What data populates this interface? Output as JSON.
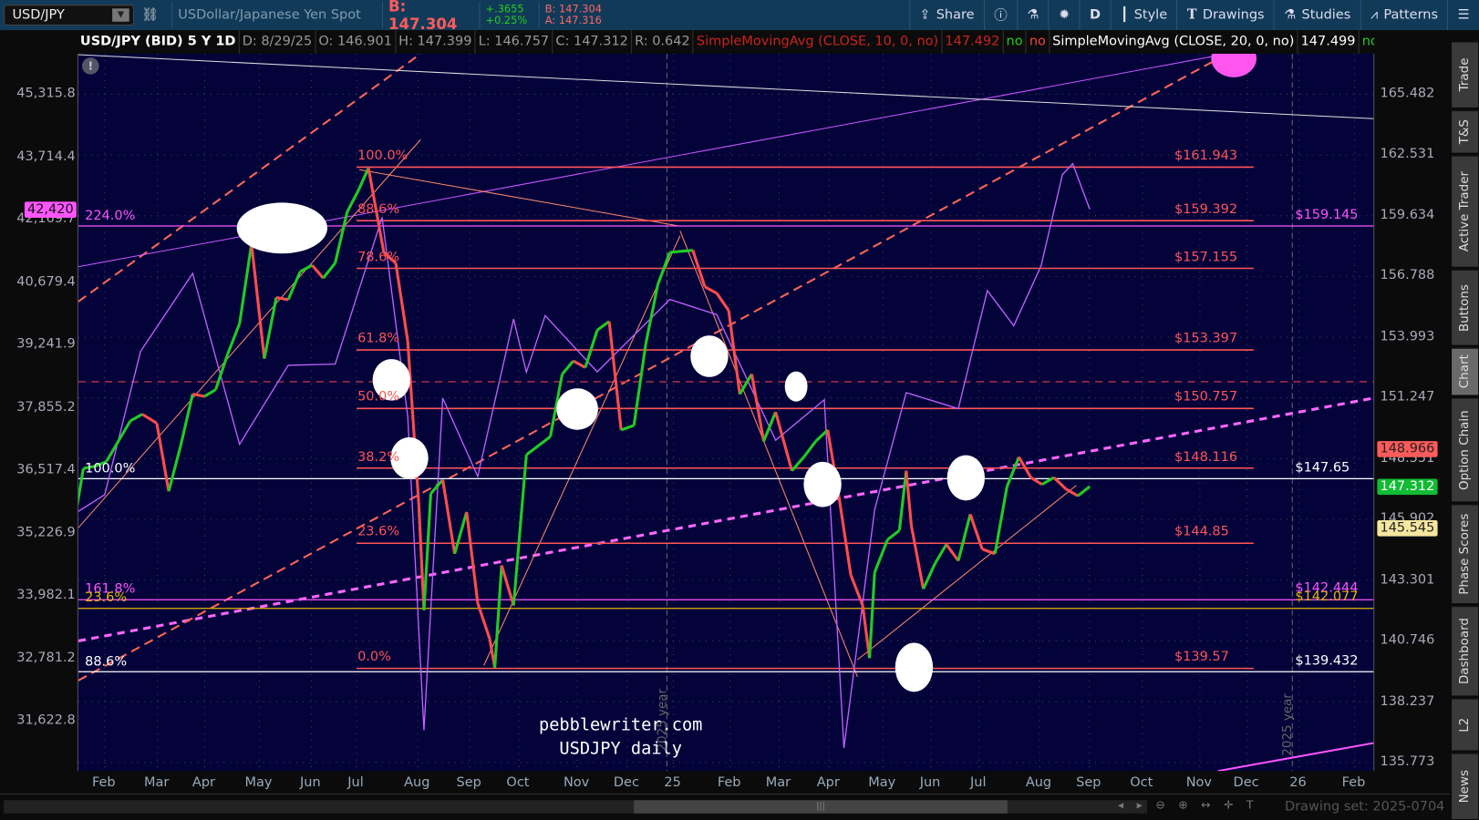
{
  "toolbar": {
    "symbol": "USD/JPY",
    "description": "USDollar/Japanese Yen Spot",
    "bid_big": "B: 147.304",
    "change": "+.3655",
    "change_pct": "+0.25%",
    "bid": "B: 147.304",
    "ask": "A: 147.316",
    "buttons": [
      {
        "label": "Share",
        "icon": "share-icon"
      },
      {
        "label": "",
        "icon": "info-icon"
      },
      {
        "label": "",
        "icon": "flask-icon"
      },
      {
        "label": "",
        "icon": "gear-icon"
      },
      {
        "label": "D",
        "icon": ""
      },
      {
        "label": "Style",
        "icon": "candle-icon"
      },
      {
        "label": "Drawings",
        "icon": "text-icon"
      },
      {
        "label": "Studies",
        "icon": "flask-icon"
      },
      {
        "label": "Patterns",
        "icon": "pattern-icon"
      },
      {
        "label": "",
        "icon": "menu-icon"
      }
    ]
  },
  "header": {
    "title": "USD/JPY (BID) 5 Y 1D",
    "date": "D: 8/29/25",
    "open": "O: 146.901",
    "high": "H: 147.399",
    "low": "L: 146.757",
    "close": "C: 147.312",
    "range": "R: 0.642",
    "study1": "SimpleMovingAvg (CLOSE, 10, 0, no)",
    "study1_val": "147.492",
    "study1_a": "no",
    "study1_b": "no",
    "study2": "SimpleMovingAvg (CLOSE, 20, 0, no)",
    "study2_val": "147.499",
    "study2_a": "no",
    "study2_b": "no",
    "more": "..."
  },
  "colors": {
    "up": "#22cc22",
    "down": "#ff4d4d",
    "fib": "#ff5555",
    "magenta": "#ff55ff",
    "overlay": "#c060ff",
    "bg": "#03033a"
  },
  "chart_data": {
    "type": "line",
    "right_axis_ticks": [
      "165.482",
      "162.531",
      "159.634",
      "156.788",
      "153.993",
      "151.247",
      "148.551",
      "145.902",
      "143.301",
      "140.746",
      "138.237",
      "135.773"
    ],
    "left_axis_ticks": [
      "45,315.8",
      "43,714.4",
      "42,169.7",
      "40,679.4",
      "39,241.9",
      "37,855.2",
      "36,517.4",
      "35,226.9",
      "33,982.1",
      "32,781.2",
      "31,622.8"
    ],
    "x_ticks": [
      "Feb",
      "Mar",
      "Apr",
      "May",
      "Jun",
      "Jul",
      "Aug",
      "Sep",
      "Oct",
      "Nov",
      "Dec",
      "25",
      "Feb",
      "Mar",
      "Apr",
      "May",
      "Jun",
      "Jul",
      "Aug",
      "Sep",
      "Oct",
      "Nov",
      "Dec",
      "26",
      "Feb"
    ],
    "price_badges": [
      {
        "label": "148.966",
        "bg": "#ff5b5b",
        "fg": "#222"
      },
      {
        "label": "147.312",
        "bg": "#11bb33",
        "fg": "#fff"
      },
      {
        "label": "145.545",
        "bg": "#f5e6a0",
        "fg": "#222"
      }
    ],
    "left_badge": "42,420",
    "usdjpy": {
      "dates": [
        "2024-01-12",
        "2024-01-19",
        "2024-01-26",
        "2024-02-02",
        "2024-02-09",
        "2024-02-16",
        "2024-02-23",
        "2024-03-01",
        "2024-03-08",
        "2024-03-15",
        "2024-03-22",
        "2024-03-29",
        "2024-04-05",
        "2024-04-12",
        "2024-04-19",
        "2024-04-26",
        "2024-05-03",
        "2024-05-10",
        "2024-05-17",
        "2024-05-24",
        "2024-05-31",
        "2024-06-07",
        "2024-06-14",
        "2024-06-21",
        "2024-06-28",
        "2024-07-03",
        "2024-07-12",
        "2024-07-19",
        "2024-07-26",
        "2024-08-02",
        "2024-08-05",
        "2024-08-09",
        "2024-08-16",
        "2024-08-23",
        "2024-08-30",
        "2024-09-06",
        "2024-09-13",
        "2024-09-16",
        "2024-09-20",
        "2024-09-27",
        "2024-10-04",
        "2024-10-11",
        "2024-10-18",
        "2024-10-25",
        "2024-11-01",
        "2024-11-08",
        "2024-11-15",
        "2024-11-22",
        "2024-11-29",
        "2024-12-06",
        "2024-12-13",
        "2024-12-20",
        "2024-12-27",
        "2025-01-10",
        "2025-01-17",
        "2025-01-24",
        "2025-01-31",
        "2025-02-07",
        "2025-02-14",
        "2025-02-21",
        "2025-02-28",
        "2025-03-07",
        "2025-03-14",
        "2025-03-21",
        "2025-03-28",
        "2025-04-04",
        "2025-04-11",
        "2025-04-18",
        "2025-04-22",
        "2025-04-25",
        "2025-05-02",
        "2025-05-09",
        "2025-05-13",
        "2025-05-16",
        "2025-05-23",
        "2025-05-30",
        "2025-06-06",
        "2025-06-13",
        "2025-06-20",
        "2025-06-27",
        "2025-07-04",
        "2025-07-11",
        "2025-07-18",
        "2025-07-25",
        "2025-08-01",
        "2025-08-08",
        "2025-08-15",
        "2025-08-22",
        "2025-08-29"
      ],
      "values": [
        145.0,
        148.1,
        148.2,
        148.4,
        149.3,
        150.2,
        150.5,
        150.1,
        147.1,
        149.1,
        151.4,
        151.3,
        151.6,
        153.2,
        154.6,
        158.3,
        153.0,
        155.8,
        155.7,
        157.0,
        157.3,
        156.7,
        157.4,
        159.8,
        160.9,
        161.9,
        157.9,
        157.4,
        153.8,
        146.5,
        142.0,
        147.0,
        147.6,
        144.4,
        146.2,
        142.3,
        140.8,
        139.6,
        143.9,
        142.2,
        148.7,
        149.1,
        149.5,
        152.3,
        152.9,
        152.6,
        154.3,
        154.7,
        149.8,
        150.0,
        153.7,
        156.4,
        157.9,
        158.0,
        156.3,
        156.0,
        155.2,
        151.4,
        152.3,
        149.3,
        150.6,
        148.0,
        148.6,
        149.3,
        149.8,
        146.9,
        143.5,
        142.2,
        140.0,
        143.6,
        145.0,
        145.4,
        148.0,
        145.6,
        142.9,
        144.0,
        144.8,
        144.1,
        146.1,
        144.6,
        144.4,
        147.3,
        148.6,
        147.7,
        147.4,
        147.7,
        147.2,
        146.9,
        147.31
      ]
    },
    "nikkei_overlay": {
      "dates": [
        "2024-01-12",
        "2024-02-01",
        "2024-02-22",
        "2024-03-22",
        "2024-04-19",
        "2024-05-17",
        "2024-06-14",
        "2024-07-11",
        "2024-07-26",
        "2024-08-05",
        "2024-08-16",
        "2024-09-06",
        "2024-09-27",
        "2024-10-04",
        "2024-10-15",
        "2024-11-15",
        "2024-12-27",
        "2025-01-24",
        "2025-02-28",
        "2025-03-26",
        "2025-04-07",
        "2025-04-25",
        "2025-05-13",
        "2025-06-13",
        "2025-06-30",
        "2025-07-15",
        "2025-07-31",
        "2025-08-13",
        "2025-08-19",
        "2025-08-29"
      ],
      "values": [
        35577,
        36011,
        39098,
        40888,
        37068,
        38787,
        38814,
        42224,
        37667,
        31458,
        38062,
        36391,
        39830,
        38635,
        39910,
        38642,
        40281,
        39931,
        37155,
        38027,
        31136,
        35705,
        38183,
        37834,
        40487,
        39678,
        41069,
        43274,
        43546,
        42420
      ]
    },
    "fib_levels": [
      {
        "pct": "100.0%",
        "price": 161.943,
        "label": "$161.943"
      },
      {
        "pct": "88.6%",
        "price": 159.392,
        "label": "$159.392"
      },
      {
        "pct": "78.6%",
        "price": 157.155,
        "label": "$157.155"
      },
      {
        "pct": "61.8%",
        "price": 153.397,
        "label": "$153.397"
      },
      {
        "pct": "50.0%",
        "price": 150.757,
        "label": "$150.757"
      },
      {
        "pct": "38.2%",
        "price": 148.116,
        "label": "$148.116"
      },
      {
        "pct": "23.6%",
        "price": 144.85,
        "label": "$144.85"
      },
      {
        "pct": "0.0%",
        "price": 139.57,
        "label": "$139.57"
      }
    ],
    "hlines": [
      {
        "pct": "224.0%",
        "price": 159.145,
        "label": "$159.145",
        "color": "#ff55ff"
      },
      {
        "pct": "100.0%",
        "price": 147.65,
        "label": "$147.65",
        "color": "#ffffff"
      },
      {
        "pct": "161.8%",
        "price": 142.444,
        "label": "$142.444",
        "color": "#ff55ff"
      },
      {
        "pct": "23.6%",
        "price": 142.077,
        "label": "$142.077",
        "color": "#e6b800"
      },
      {
        "pct": "88.6%",
        "price": 139.432,
        "label": "$139.432",
        "color": "#ffffff"
      }
    ]
  },
  "watermark": {
    "line1": "pebblewriter.com",
    "line2": "USDJPY daily"
  },
  "year_markers": [
    "2025 year",
    "2025 year"
  ],
  "tabs": [
    "Trade",
    "T&S",
    "Active Trader",
    "Buttons",
    "Chart",
    "Option Chain",
    "Phase Scores",
    "Dashboard",
    "L2",
    "News"
  ],
  "footer": {
    "drawing_set": "Drawing set: 2025-0704"
  }
}
